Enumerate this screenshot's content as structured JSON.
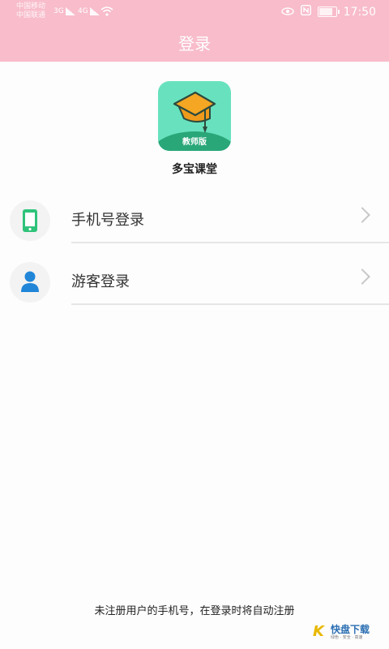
{
  "status_bar": {
    "carrier_1": "中国移动",
    "carrier_2": "中国联通",
    "signal_1_type": "3G",
    "signal_2_type": "4G",
    "battery_level": 0.8,
    "time": "17:50"
  },
  "header": {
    "title": "登录"
  },
  "app": {
    "badge": "教师版",
    "name": "多宝课堂"
  },
  "login_options": [
    {
      "label": "手机号登录",
      "icon": "phone-icon",
      "icon_color": "#2fc37a"
    },
    {
      "label": "游客登录",
      "icon": "user-icon",
      "icon_color": "#2186d8"
    }
  ],
  "footer": {
    "note": "未注册用户的手机号，在登录时将自动注册"
  },
  "watermark": {
    "mark": "K",
    "text": "快盘下载",
    "sub": "绿色 · 安全 · 高速"
  },
  "colors": {
    "header_bg": "#f8bccb",
    "logo_bg": "#68e2be",
    "cap": "#f5a623"
  }
}
